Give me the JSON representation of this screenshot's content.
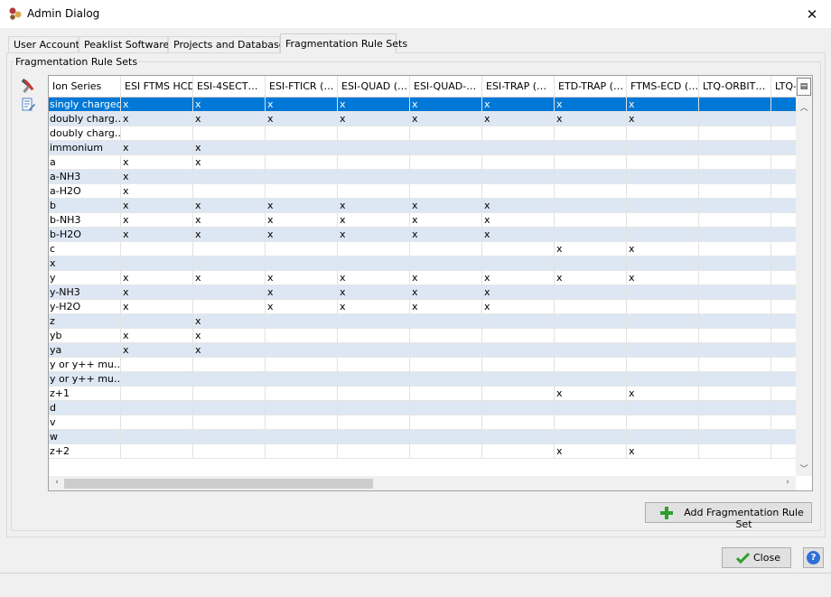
{
  "window": {
    "title": "Admin Dialog"
  },
  "tabs": [
    {
      "label": "User Accounts"
    },
    {
      "label": "Peaklist Softwares"
    },
    {
      "label": "Projects and Databases"
    },
    {
      "label": "Fragmentation Rule Sets",
      "active": true
    }
  ],
  "group": {
    "title": "Fragmentation Rule Sets"
  },
  "table": {
    "columns": [
      "Ion Series",
      "ESI FTMS HCD",
      "ESI-4SECT…",
      "ESI-FTICR (…",
      "ESI-QUAD (…",
      "ESI-QUAD-…",
      "ESI-TRAP (…",
      "ETD-TRAP (…",
      "FTMS-ECD (…",
      "LTQ-ORBIT…",
      "LTQ-"
    ],
    "rows": [
      [
        "singly charged",
        "x",
        "x",
        "x",
        "x",
        "x",
        "x",
        "x",
        "x",
        "",
        ""
      ],
      [
        "doubly charg…",
        "x",
        "x",
        "x",
        "x",
        "x",
        "x",
        "x",
        "x",
        "",
        ""
      ],
      [
        "doubly charg…",
        "",
        "",
        "",
        "",
        "",
        "",
        "",
        "",
        "",
        ""
      ],
      [
        "immonium",
        "x",
        "x",
        "",
        "",
        "",
        "",
        "",
        "",
        "",
        ""
      ],
      [
        "a",
        "x",
        "x",
        "",
        "",
        "",
        "",
        "",
        "",
        "",
        ""
      ],
      [
        "a-NH3",
        "x",
        "",
        "",
        "",
        "",
        "",
        "",
        "",
        "",
        ""
      ],
      [
        "a-H2O",
        "x",
        "",
        "",
        "",
        "",
        "",
        "",
        "",
        "",
        ""
      ],
      [
        "b",
        "x",
        "x",
        "x",
        "x",
        "x",
        "x",
        "",
        "",
        "",
        ""
      ],
      [
        "b-NH3",
        "x",
        "x",
        "x",
        "x",
        "x",
        "x",
        "",
        "",
        "",
        ""
      ],
      [
        "b-H2O",
        "x",
        "x",
        "x",
        "x",
        "x",
        "x",
        "",
        "",
        "",
        ""
      ],
      [
        "c",
        "",
        "",
        "",
        "",
        "",
        "",
        "x",
        "x",
        "",
        ""
      ],
      [
        "x",
        "",
        "",
        "",
        "",
        "",
        "",
        "",
        "",
        "",
        ""
      ],
      [
        "y",
        "x",
        "x",
        "x",
        "x",
        "x",
        "x",
        "x",
        "x",
        "",
        ""
      ],
      [
        "y-NH3",
        "x",
        "",
        "x",
        "x",
        "x",
        "x",
        "",
        "",
        "",
        ""
      ],
      [
        "y-H2O",
        "x",
        "",
        "x",
        "x",
        "x",
        "x",
        "",
        "",
        "",
        ""
      ],
      [
        "z",
        "",
        "x",
        "",
        "",
        "",
        "",
        "",
        "",
        "",
        ""
      ],
      [
        "yb",
        "x",
        "x",
        "",
        "",
        "",
        "",
        "",
        "",
        "",
        ""
      ],
      [
        "ya",
        "x",
        "x",
        "",
        "",
        "",
        "",
        "",
        "",
        "",
        ""
      ],
      [
        "y or y++ mu…",
        "",
        "",
        "",
        "",
        "",
        "",
        "",
        "",
        "",
        ""
      ],
      [
        "y or y++ mu…",
        "",
        "",
        "",
        "",
        "",
        "",
        "",
        "",
        "",
        ""
      ],
      [
        "z+1",
        "",
        "",
        "",
        "",
        "",
        "",
        "x",
        "x",
        "",
        ""
      ],
      [
        "d",
        "",
        "",
        "",
        "",
        "",
        "",
        "",
        "",
        "",
        ""
      ],
      [
        "v",
        "",
        "",
        "",
        "",
        "",
        "",
        "",
        "",
        "",
        ""
      ],
      [
        "w",
        "",
        "",
        "",
        "",
        "",
        "",
        "",
        "",
        "",
        ""
      ],
      [
        "z+2",
        "",
        "",
        "",
        "",
        "",
        "",
        "x",
        "x",
        "",
        ""
      ]
    ],
    "selected_row": 0
  },
  "buttons": {
    "add_rule_set": "Add Fragmentation Rule Set",
    "close": "Close",
    "help": "?"
  },
  "colors": {
    "selection": "#0078d7",
    "alt_row": "#dde7f4",
    "add_icon": "#2e9e2e",
    "help_icon": "#2f6fd6"
  }
}
